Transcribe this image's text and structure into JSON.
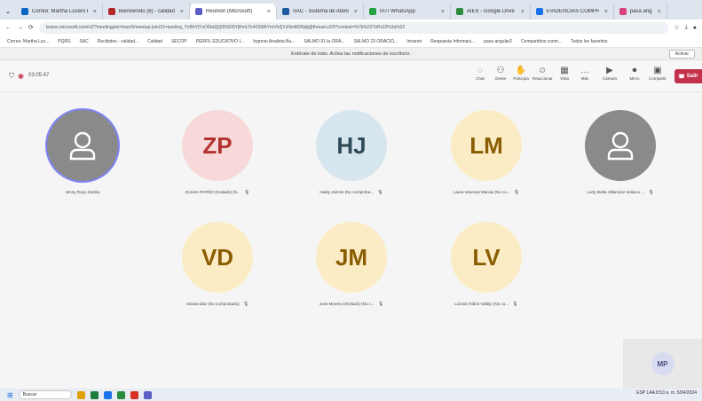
{
  "browser": {
    "tabs": [
      {
        "label": "Correo: Martha Lucero D...",
        "color": "#0a66c2",
        "active": false
      },
      {
        "label": "Bienvenido (8) - calidad...",
        "color": "#b3262a",
        "active": false
      },
      {
        "label": "Reunión (Microsoft)",
        "color": "#5b5fc7",
        "active": true
      },
      {
        "label": "SAC - Sistema de Atención",
        "color": "#1e5aa0",
        "active": false
      },
      {
        "label": "IATI WhatsApp",
        "color": "#25a244",
        "active": false
      },
      {
        "label": "AIES - Google Drive",
        "color": "#2b8a3e",
        "active": false
      },
      {
        "label": "EVIDENCIAS COMPROM...",
        "color": "#1a73e8",
        "active": false
      },
      {
        "label": "pasa angular2",
        "color": "#d9427b",
        "active": false
      }
    ],
    "url": "teams.microsoft.com/v2/?meetingjoin=true#/l/meetup-join/19:meeting_YzBhYjYxODktZjQ0NS00YjRmLTk4ODMtYmVhZjYzNmM2Njdj@thread.v2/0?context=%7b%22Tid%22%3a%22",
    "bookmarks": [
      "Correo: Martha Luc...",
      "PQRS",
      "SAC",
      "Recibidos - calidad...",
      "Calidad",
      "SECOP",
      "PERFIL EDUCATIVO I...",
      "Ingreso Analista Bu...",
      "SALMO 91 la ORA...",
      "SALMO 23 ORACIÓ...",
      "Intranet",
      "Respuesta Informaci...",
      "pasa angular2",
      "Compartidos conm...",
      "Todos los favoritos"
    ]
  },
  "notification": {
    "text": "Entérate de todo. Activa las notificaciones de escritorio.",
    "action": "Activar"
  },
  "meeting": {
    "timer": "03:05:47",
    "tools": [
      {
        "label": "Chat",
        "icon": "chat-icon",
        "glyph": "◌"
      },
      {
        "label": "Gente",
        "icon": "people-icon",
        "glyph": "⚇"
      },
      {
        "label": "Participa",
        "icon": "raise-hand-icon",
        "glyph": "✋"
      },
      {
        "label": "Reaccionar",
        "icon": "emoji-icon",
        "glyph": "☺"
      },
      {
        "label": "Vista",
        "icon": "view-icon",
        "glyph": "▦"
      },
      {
        "label": "Más",
        "icon": "more-icon",
        "glyph": "…"
      },
      {
        "label": "Cámara",
        "icon": "camera-icon",
        "glyph": "▶"
      },
      {
        "label": "Micro",
        "icon": "mic-icon",
        "glyph": "⏺"
      },
      {
        "label": "Compartir",
        "icon": "share-icon",
        "glyph": "▣"
      }
    ],
    "leave_label": "Salir"
  },
  "participants": [
    {
      "initials": "",
      "name": "Jenny Royo Zambo",
      "bg": "#8a8a8a",
      "fg": "#ffffff",
      "person_icon": true,
      "ring": true
    },
    {
      "initials": "ZP",
      "name": "ZULMA PATIÑO (Invitado) (N...",
      "bg": "#f7d9d9",
      "fg": "#b3322f",
      "person_icon": false,
      "ring": false
    },
    {
      "initials": "HJ",
      "name": "Haidy Jazmin (No comproba...",
      "bg": "#d7e6ee",
      "fg": "#2e4a59",
      "person_icon": false,
      "ring": false
    },
    {
      "initials": "LM",
      "name": "Laura Vanessa Macias (No co...",
      "bg": "#fcecc6",
      "fg": "#8a5d00",
      "person_icon": false,
      "ring": false
    },
    {
      "initials": "",
      "name": "Ludy Stella Villamizar Velasco ...",
      "bg": "#8a8a8a",
      "fg": "#ffffff",
      "person_icon": true,
      "ring": false
    },
    {
      "initials": "VD",
      "name": "viviana diaz (No comprobado)",
      "bg": "#fcecc6",
      "fg": "#8a5d00",
      "person_icon": false,
      "ring": false
    },
    {
      "initials": "JM",
      "name": "Jose Moreno (Invitado) (No c...",
      "bg": "#fcecc6",
      "fg": "#8a5d00",
      "person_icon": false,
      "ring": false
    },
    {
      "initials": "LV",
      "name": "Lizzara Tobón Vallejo (No co...",
      "bg": "#fcecc6",
      "fg": "#8a5d00",
      "person_icon": false,
      "ring": false
    }
  ],
  "self_view": {
    "initials": "MP"
  },
  "taskbar": {
    "search_placeholder": "Buscar",
    "tray": "ESP LAA 8:53 a. m. 5/04/2024"
  }
}
